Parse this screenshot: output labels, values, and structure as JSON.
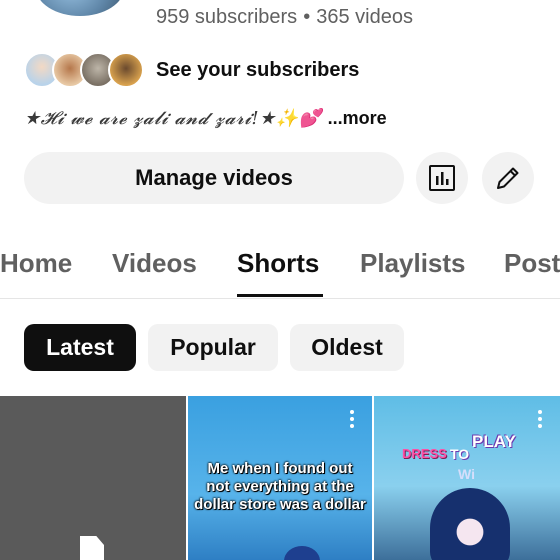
{
  "channel": {
    "subscribers": "959 subscribers",
    "separator": "•",
    "videos": "365 videos",
    "see_subscribers": "See your subscribers",
    "bio": "★𝓗𝓲 𝔀𝓮 𝓪𝓻𝓮 𝔃𝓪𝓵𝓲 𝓪𝓷𝓭 𝔃𝓪𝓻𝓲!★✨💕",
    "more": "...more"
  },
  "actions": {
    "manage_videos": "Manage videos",
    "analytics_icon": "analytics-icon",
    "edit_icon": "pencil-icon"
  },
  "tabs": [
    {
      "label": "Home"
    },
    {
      "label": "Videos"
    },
    {
      "label": "Shorts",
      "active": true
    },
    {
      "label": "Playlists"
    },
    {
      "label": "Posts"
    }
  ],
  "filters": [
    {
      "label": "Latest",
      "active": true
    },
    {
      "label": "Popular"
    },
    {
      "label": "Oldest"
    }
  ],
  "shorts": [
    {
      "caption": ""
    },
    {
      "caption": "Me when I found out not everything at the dollar store was a dollar"
    },
    {
      "title_play": "PLAY",
      "title_dress": "DRESS",
      "title_to": "TO",
      "title_wi": "Wi"
    }
  ],
  "colors": {
    "text_primary": "#0f0f0f",
    "text_secondary": "#606060",
    "chip_bg": "#f2f2f2",
    "chip_active_bg": "#0f0f0f"
  }
}
